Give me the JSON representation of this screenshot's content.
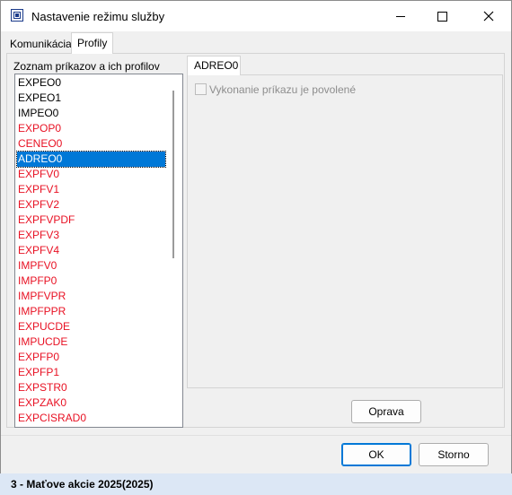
{
  "window": {
    "title": "Nastavenie režimu služby"
  },
  "tabs": {
    "komunikacia": "Komunikácia",
    "profily": "Profily"
  },
  "list": {
    "label": "Zoznam príkazov a ich profilov",
    "items": [
      {
        "text": "EXPEO0",
        "color": "#000000"
      },
      {
        "text": "EXPEO1",
        "color": "#000000"
      },
      {
        "text": "IMPEO0",
        "color": "#000000"
      },
      {
        "text": "EXPOP0",
        "color": "#e81123"
      },
      {
        "text": "CENEO0",
        "color": "#e81123"
      },
      {
        "text": "ADREO0",
        "color": "#000000",
        "selected": true
      },
      {
        "text": "EXPFV0",
        "color": "#e81123"
      },
      {
        "text": "EXPFV1",
        "color": "#e81123"
      },
      {
        "text": "EXPFV2",
        "color": "#e81123"
      },
      {
        "text": "EXPFVPDF",
        "color": "#e81123"
      },
      {
        "text": "EXPFV3",
        "color": "#e81123"
      },
      {
        "text": "EXPFV4",
        "color": "#e81123"
      },
      {
        "text": "IMPFV0",
        "color": "#e81123"
      },
      {
        "text": "IMPFP0",
        "color": "#e81123"
      },
      {
        "text": "IMPFVPR",
        "color": "#e81123"
      },
      {
        "text": "IMPFPPR",
        "color": "#e81123"
      },
      {
        "text": "EXPUCDE",
        "color": "#e81123"
      },
      {
        "text": "IMPUCDE",
        "color": "#e81123"
      },
      {
        "text": "EXPFP0",
        "color": "#e81123"
      },
      {
        "text": "EXPFP1",
        "color": "#e81123"
      },
      {
        "text": "EXPSTR0",
        "color": "#e81123"
      },
      {
        "text": "EXPZAK0",
        "color": "#e81123"
      },
      {
        "text": "EXPCISRAD0",
        "color": "#e81123"
      }
    ]
  },
  "detail": {
    "tab_label": "ADREO0",
    "checkbox_label": "Vykonanie príkazu je povolené",
    "checkbox_checked": false
  },
  "buttons": {
    "oprava": "Oprava",
    "ok": "OK",
    "storno": "Storno"
  },
  "statusbar": {
    "text": "3 - Maťove akcie 2025(2025)"
  },
  "colors": {
    "selection": "#0078d7",
    "error_text": "#e81123",
    "statusbar_bg": "#dce7f5"
  }
}
